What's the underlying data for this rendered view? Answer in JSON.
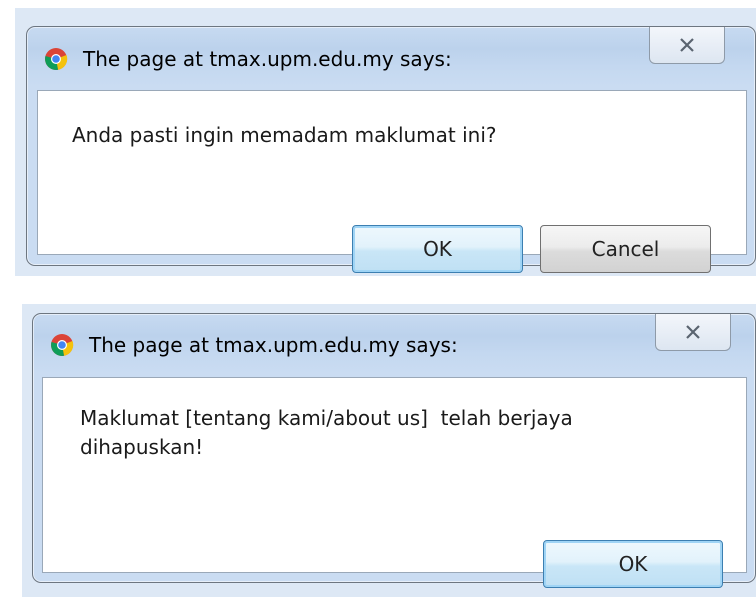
{
  "dialog_confirm": {
    "title": "The page at tmax.upm.edu.my says:",
    "message": "Anda pasti ingin memadam maklumat ini?",
    "ok_label": "OK",
    "cancel_label": "Cancel",
    "icon": "chrome-icon",
    "close_icon": "close-icon"
  },
  "dialog_alert": {
    "title": "The page at tmax.upm.edu.my says:",
    "message_line1": "Maklumat [tentang kami/about us]  telah berjaya",
    "message_line2": "dihapuskan!",
    "ok_label": "OK",
    "icon": "chrome-icon",
    "close_icon": "close-icon"
  },
  "colors": {
    "frame": "#c4d8f0",
    "default_button_border": "#3c7fb1"
  }
}
